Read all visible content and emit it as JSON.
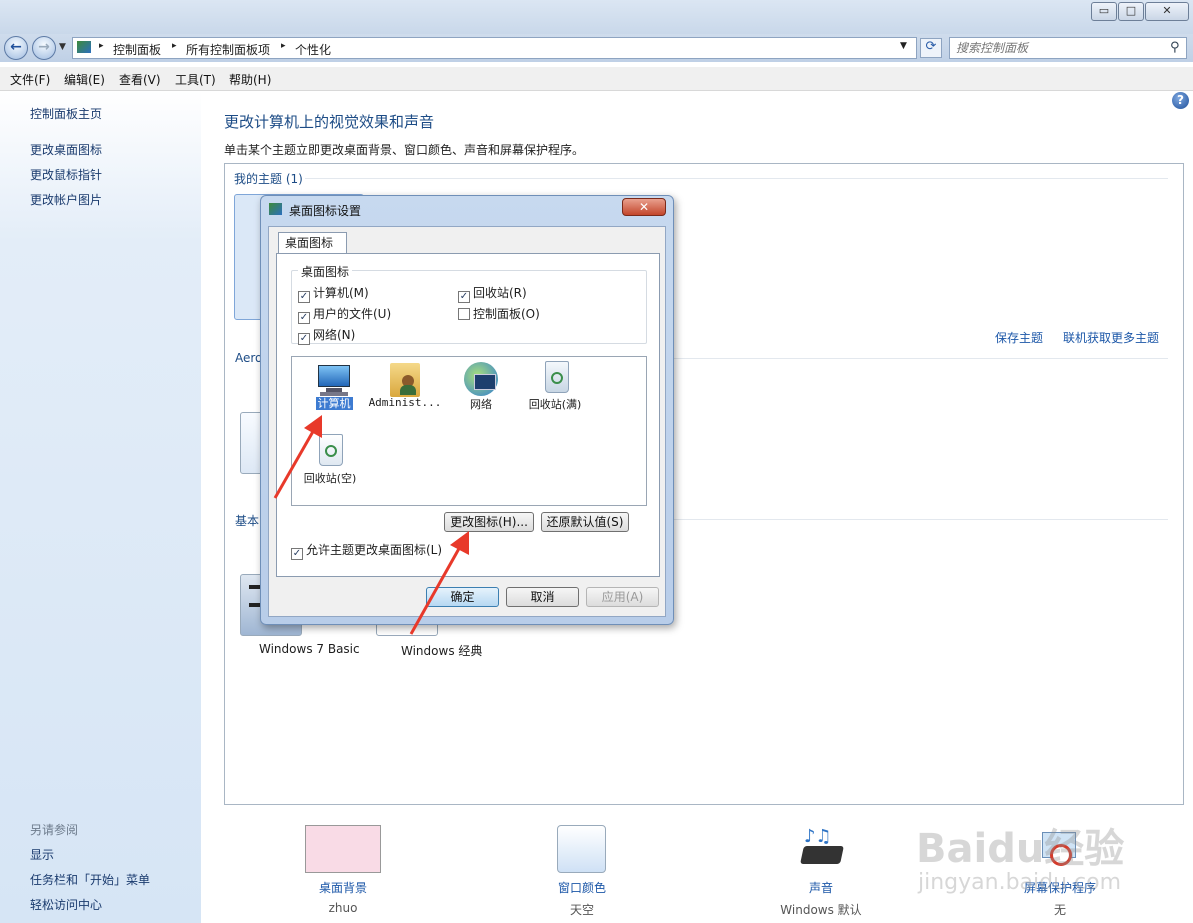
{
  "window": {
    "minimize": "▭",
    "maximize": "□",
    "close": "✕"
  },
  "address": {
    "crumbs": [
      "控制面板",
      "所有控制面板项",
      "个性化"
    ],
    "separator": "▸"
  },
  "search": {
    "placeholder": "搜索控制面板"
  },
  "menubar": [
    "文件(F)",
    "编辑(E)",
    "查看(V)",
    "工具(T)",
    "帮助(H)"
  ],
  "sidebar": {
    "items": [
      "控制面板主页",
      "更改桌面图标",
      "更改鼠标指针",
      "更改帐户图片"
    ],
    "see_also_title": "另请参阅",
    "see_also": [
      "显示",
      "任务栏和「开始」菜单",
      "轻松访问中心"
    ]
  },
  "main": {
    "title": "更改计算机上的视觉效果和声音",
    "subtitle": "单击某个主题立即更改桌面背景、窗口颜色、声音和屏幕保护程序。",
    "my_themes": "我的主题 (1)",
    "save_theme": "保存主题",
    "get_more": "联机获取更多主题",
    "aero": "Aero",
    "basic": "基本",
    "basic_themes": [
      "Windows 7 Basic",
      "Windows 经典"
    ]
  },
  "bottom": [
    {
      "label": "桌面背景",
      "value": "zhuo",
      "color": "#f9dbe6"
    },
    {
      "label": "窗口颜色",
      "value": "天空",
      "color": "#cfe1f5"
    },
    {
      "label": "声音",
      "value": "Windows 默认"
    },
    {
      "label": "屏幕保护程序",
      "value": "无"
    }
  ],
  "dialog": {
    "title": "桌面图标设置",
    "tab": "桌面图标",
    "group_title": "桌面图标",
    "checkboxes": [
      {
        "label": "计算机(M)",
        "checked": true
      },
      {
        "label": "回收站(R)",
        "checked": true
      },
      {
        "label": "用户的文件(U)",
        "checked": true
      },
      {
        "label": "控制面板(O)",
        "checked": false
      },
      {
        "label": "网络(N)",
        "checked": true
      }
    ],
    "icons": [
      "计算机",
      "Administ...",
      "网络",
      "回收站(满)",
      "回收站(空)"
    ],
    "change_icon": "更改图标(H)...",
    "restore_default": "还原默认值(S)",
    "allow_themes": "允许主题更改桌面图标(L)",
    "ok": "确定",
    "cancel": "取消",
    "apply": "应用(A)"
  },
  "watermark": {
    "brand": "Baidu经验",
    "url": "jingyan.baidu.com"
  },
  "colors": {
    "accent": "#1c57a8",
    "arrow": "#e8392a",
    "selection": "#3d7bd1"
  }
}
